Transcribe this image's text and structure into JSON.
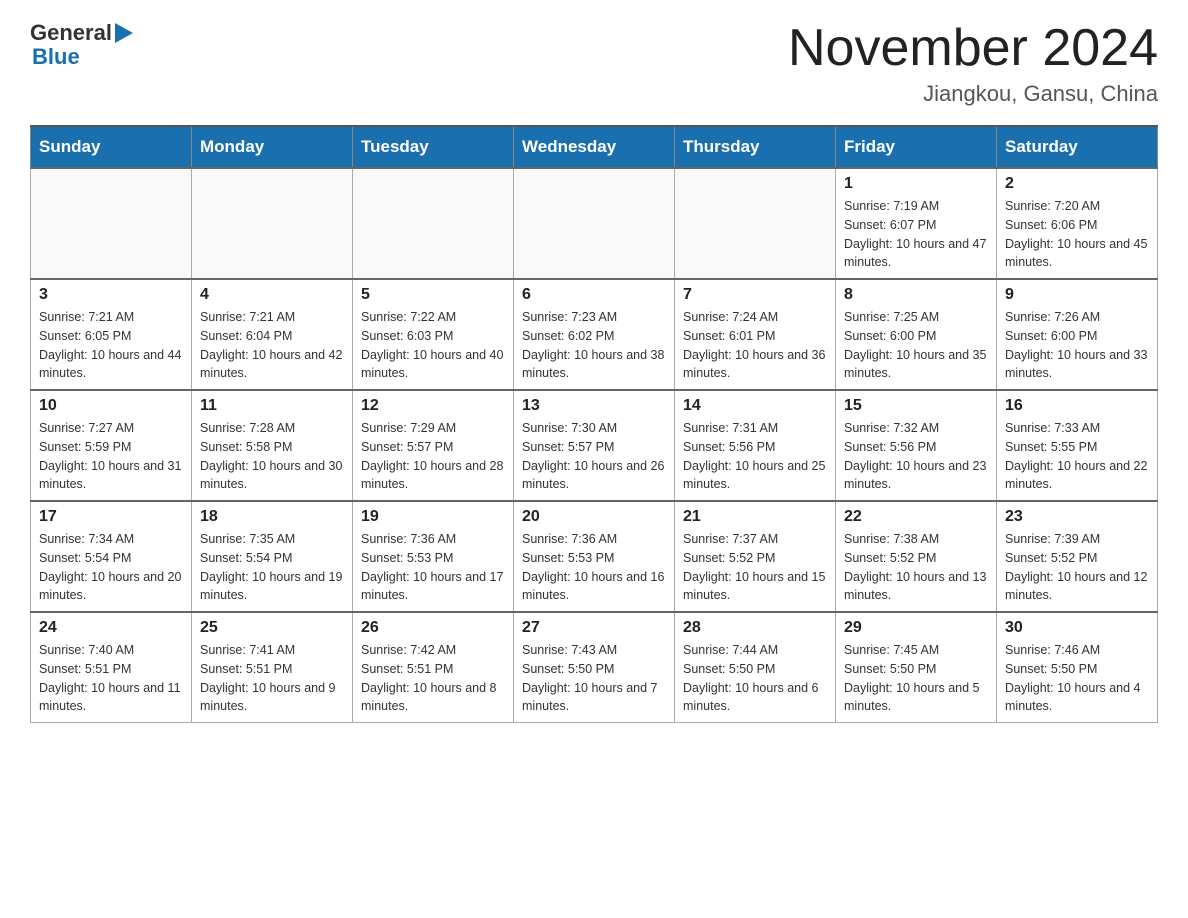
{
  "header": {
    "logo_general": "General",
    "logo_blue": "Blue",
    "month_title": "November 2024",
    "location": "Jiangkou, Gansu, China"
  },
  "weekdays": [
    "Sunday",
    "Monday",
    "Tuesday",
    "Wednesday",
    "Thursday",
    "Friday",
    "Saturday"
  ],
  "weeks": [
    [
      {
        "day": "",
        "info": ""
      },
      {
        "day": "",
        "info": ""
      },
      {
        "day": "",
        "info": ""
      },
      {
        "day": "",
        "info": ""
      },
      {
        "day": "",
        "info": ""
      },
      {
        "day": "1",
        "info": "Sunrise: 7:19 AM\nSunset: 6:07 PM\nDaylight: 10 hours and 47 minutes."
      },
      {
        "day": "2",
        "info": "Sunrise: 7:20 AM\nSunset: 6:06 PM\nDaylight: 10 hours and 45 minutes."
      }
    ],
    [
      {
        "day": "3",
        "info": "Sunrise: 7:21 AM\nSunset: 6:05 PM\nDaylight: 10 hours and 44 minutes."
      },
      {
        "day": "4",
        "info": "Sunrise: 7:21 AM\nSunset: 6:04 PM\nDaylight: 10 hours and 42 minutes."
      },
      {
        "day": "5",
        "info": "Sunrise: 7:22 AM\nSunset: 6:03 PM\nDaylight: 10 hours and 40 minutes."
      },
      {
        "day": "6",
        "info": "Sunrise: 7:23 AM\nSunset: 6:02 PM\nDaylight: 10 hours and 38 minutes."
      },
      {
        "day": "7",
        "info": "Sunrise: 7:24 AM\nSunset: 6:01 PM\nDaylight: 10 hours and 36 minutes."
      },
      {
        "day": "8",
        "info": "Sunrise: 7:25 AM\nSunset: 6:00 PM\nDaylight: 10 hours and 35 minutes."
      },
      {
        "day": "9",
        "info": "Sunrise: 7:26 AM\nSunset: 6:00 PM\nDaylight: 10 hours and 33 minutes."
      }
    ],
    [
      {
        "day": "10",
        "info": "Sunrise: 7:27 AM\nSunset: 5:59 PM\nDaylight: 10 hours and 31 minutes."
      },
      {
        "day": "11",
        "info": "Sunrise: 7:28 AM\nSunset: 5:58 PM\nDaylight: 10 hours and 30 minutes."
      },
      {
        "day": "12",
        "info": "Sunrise: 7:29 AM\nSunset: 5:57 PM\nDaylight: 10 hours and 28 minutes."
      },
      {
        "day": "13",
        "info": "Sunrise: 7:30 AM\nSunset: 5:57 PM\nDaylight: 10 hours and 26 minutes."
      },
      {
        "day": "14",
        "info": "Sunrise: 7:31 AM\nSunset: 5:56 PM\nDaylight: 10 hours and 25 minutes."
      },
      {
        "day": "15",
        "info": "Sunrise: 7:32 AM\nSunset: 5:56 PM\nDaylight: 10 hours and 23 minutes."
      },
      {
        "day": "16",
        "info": "Sunrise: 7:33 AM\nSunset: 5:55 PM\nDaylight: 10 hours and 22 minutes."
      }
    ],
    [
      {
        "day": "17",
        "info": "Sunrise: 7:34 AM\nSunset: 5:54 PM\nDaylight: 10 hours and 20 minutes."
      },
      {
        "day": "18",
        "info": "Sunrise: 7:35 AM\nSunset: 5:54 PM\nDaylight: 10 hours and 19 minutes."
      },
      {
        "day": "19",
        "info": "Sunrise: 7:36 AM\nSunset: 5:53 PM\nDaylight: 10 hours and 17 minutes."
      },
      {
        "day": "20",
        "info": "Sunrise: 7:36 AM\nSunset: 5:53 PM\nDaylight: 10 hours and 16 minutes."
      },
      {
        "day": "21",
        "info": "Sunrise: 7:37 AM\nSunset: 5:52 PM\nDaylight: 10 hours and 15 minutes."
      },
      {
        "day": "22",
        "info": "Sunrise: 7:38 AM\nSunset: 5:52 PM\nDaylight: 10 hours and 13 minutes."
      },
      {
        "day": "23",
        "info": "Sunrise: 7:39 AM\nSunset: 5:52 PM\nDaylight: 10 hours and 12 minutes."
      }
    ],
    [
      {
        "day": "24",
        "info": "Sunrise: 7:40 AM\nSunset: 5:51 PM\nDaylight: 10 hours and 11 minutes."
      },
      {
        "day": "25",
        "info": "Sunrise: 7:41 AM\nSunset: 5:51 PM\nDaylight: 10 hours and 9 minutes."
      },
      {
        "day": "26",
        "info": "Sunrise: 7:42 AM\nSunset: 5:51 PM\nDaylight: 10 hours and 8 minutes."
      },
      {
        "day": "27",
        "info": "Sunrise: 7:43 AM\nSunset: 5:50 PM\nDaylight: 10 hours and 7 minutes."
      },
      {
        "day": "28",
        "info": "Sunrise: 7:44 AM\nSunset: 5:50 PM\nDaylight: 10 hours and 6 minutes."
      },
      {
        "day": "29",
        "info": "Sunrise: 7:45 AM\nSunset: 5:50 PM\nDaylight: 10 hours and 5 minutes."
      },
      {
        "day": "30",
        "info": "Sunrise: 7:46 AM\nSunset: 5:50 PM\nDaylight: 10 hours and 4 minutes."
      }
    ]
  ]
}
